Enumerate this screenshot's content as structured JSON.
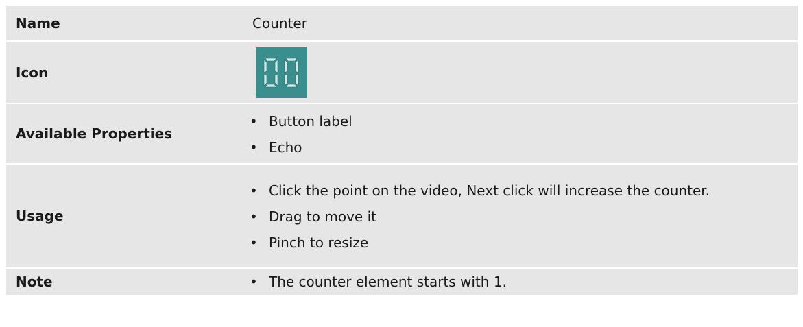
{
  "rows": {
    "name": {
      "label": "Name",
      "value": "Counter"
    },
    "icon": {
      "label": "Icon",
      "icon_name": "counter-icon",
      "icon_color": "#3a8e8e"
    },
    "properties": {
      "label": "Available Properties",
      "items": [
        "Button label",
        "Echo"
      ]
    },
    "usage": {
      "label": "Usage",
      "items": [
        "Click the point on the video, Next click will increase the counter.",
        "Drag to move it",
        "Pinch to resize"
      ]
    },
    "note": {
      "label": "Note",
      "items": [
        "The counter element starts with 1."
      ]
    }
  }
}
